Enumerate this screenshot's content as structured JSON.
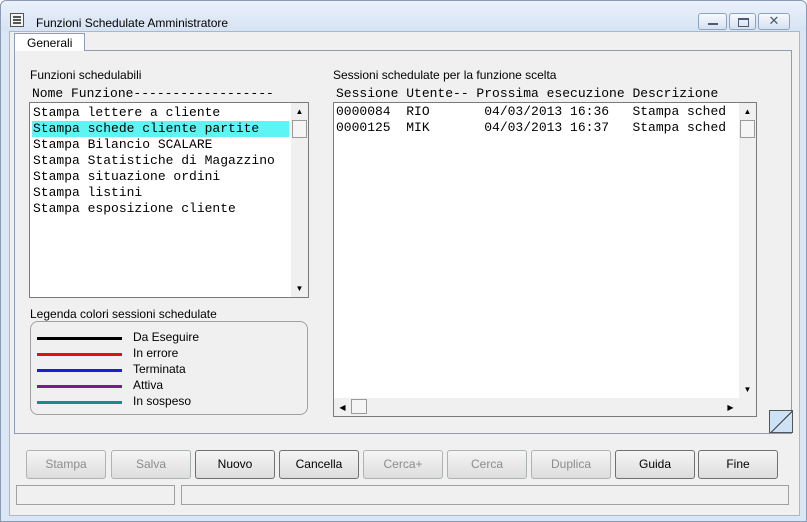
{
  "window": {
    "title": "Funzioni Schedulate Amministratore"
  },
  "tabs": [
    {
      "label": "Generali"
    }
  ],
  "functions": {
    "label": "Funzioni schedulabili",
    "header": "Nome Funzione------------------",
    "items": [
      "Stampa lettere a cliente",
      "Stampa schede cliente partite",
      "Stampa Bilancio SCALARE",
      "Stampa Statistiche di Magazzino",
      "Stampa situazione ordini",
      "Stampa listini",
      "Stampa esposizione cliente"
    ],
    "selected_index": 1,
    "selected_color": "#5ff4f4"
  },
  "sessions": {
    "label": "Sessioni schedulate per la funzione scelta",
    "header": "Sessione Utente-- Prossima esecuzione Descrizione",
    "rows": [
      "0000084  RIO       04/03/2013 16:36   Stampa sched",
      "0000125  MIK       04/03/2013 16:37   Stampa sched"
    ]
  },
  "legend": {
    "label": "Legenda colori sessioni schedulate",
    "items": [
      {
        "label": "Da Eseguire",
        "color": "#000000"
      },
      {
        "label": "In errore",
        "color": "#e01010"
      },
      {
        "label": "Terminata",
        "color": "#1b1bd8"
      },
      {
        "label": "Attiva",
        "color": "#7a1a8c"
      },
      {
        "label": "In sospeso",
        "color": "#1a8a8a"
      }
    ]
  },
  "buttons": [
    {
      "label": "Stampa",
      "enabled": false
    },
    {
      "label": "Salva",
      "enabled": false
    },
    {
      "label": "Nuovo",
      "enabled": true
    },
    {
      "label": "Cancella",
      "enabled": true
    },
    {
      "label": "Cerca+",
      "enabled": false
    },
    {
      "label": "Cerca",
      "enabled": false
    },
    {
      "label": "Duplica",
      "enabled": false
    },
    {
      "label": "Guida",
      "enabled": true
    },
    {
      "label": "Fine",
      "enabled": true
    }
  ]
}
